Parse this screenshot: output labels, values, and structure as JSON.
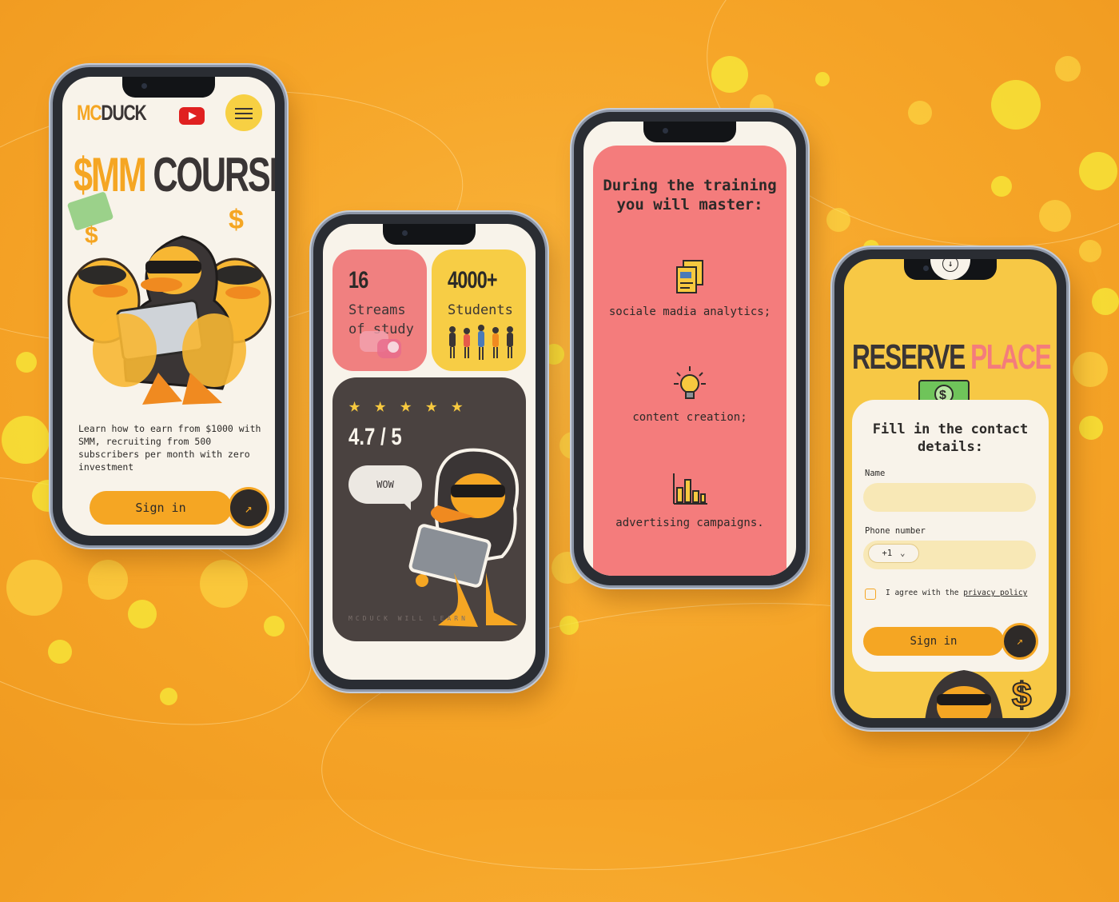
{
  "colors": {
    "background": "#f6a528",
    "accent": "#f5a623",
    "dark": "#3a3535",
    "pink": "#f47c7c",
    "yellow": "#f7cd45",
    "cream": "#f8f3ea"
  },
  "screen1": {
    "logo_prefix": "MC",
    "logo_suffix": "DUCK",
    "youtube_icon": "youtube-icon",
    "menu_icon": "hamburger-icon",
    "title_accent": "$MM",
    "title_main": "COURSE",
    "description": "Learn how to earn from $1000 with SMM, recruiting from 500 subscribers per month with zero investment",
    "cta_label": "Sign in",
    "cta_icon": "arrow-up-right-icon"
  },
  "screen2": {
    "streams_count": "16",
    "streams_label": "Streams of study",
    "students_count": "4000+",
    "students_label": "Students",
    "stars": 5,
    "rating": "4.7 / 5",
    "bubble": "WOW",
    "watermark": "MCDUCK WILL LEARN"
  },
  "screen3": {
    "title": "During the training you will master:",
    "skills": [
      {
        "label": "sociale madia analytics;",
        "icon": "documents-icon"
      },
      {
        "label": "content creation;",
        "icon": "lightbulb-icon"
      },
      {
        "label": "advertising campaigns.",
        "icon": "bar-chart-icon"
      }
    ]
  },
  "screen4": {
    "title_main": "RESERVE",
    "title_accent": "PLACE",
    "form_title": "Fill in the contact details:",
    "name_label": "Name",
    "name_value": "",
    "phone_label": "Phone number",
    "country_code": "+1",
    "phone_value": "",
    "agree_text": "I agree with the",
    "agree_link": "privacy policy",
    "cta_label": "Sign in",
    "cta_icon": "arrow-up-right-icon"
  }
}
